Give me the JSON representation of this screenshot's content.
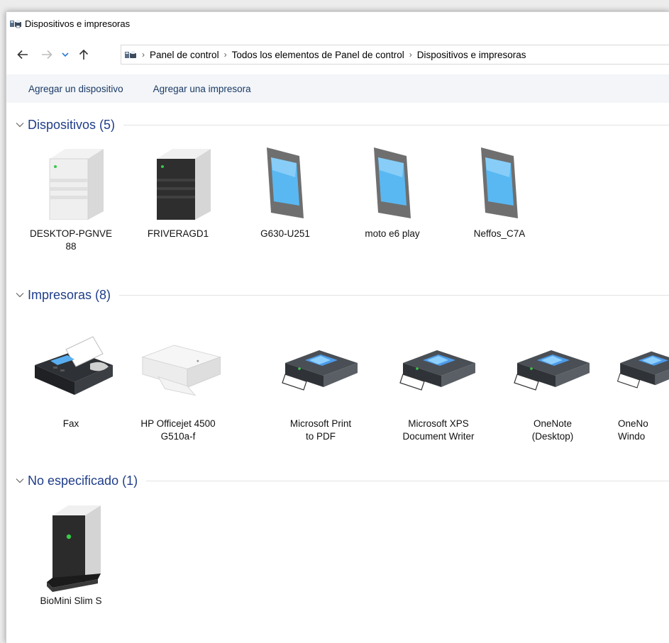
{
  "window": {
    "title": "Dispositivos e impresoras"
  },
  "nav": {
    "breadcrumbs": [
      "Panel de control",
      "Todos los elementos de Panel de control",
      "Dispositivos e impresoras"
    ]
  },
  "toolbar": {
    "add_device": "Agregar un dispositivo",
    "add_printer": "Agregar una impresora"
  },
  "groups": {
    "devices": {
      "title": "Dispositivos (5)",
      "items": [
        {
          "label": "DESKTOP-PGNVE\n88",
          "icon": "desktop-tower-icon"
        },
        {
          "label": "FRIVERAGD1",
          "icon": "server-tower-icon"
        },
        {
          "label": "G630-U251",
          "icon": "phone-icon"
        },
        {
          "label": "moto e6 play",
          "icon": "phone-icon"
        },
        {
          "label": "Neffos_C7A",
          "icon": "phone-icon"
        }
      ]
    },
    "printers": {
      "title": "Impresoras (8)",
      "items": [
        {
          "label": "Fax",
          "icon": "fax-icon"
        },
        {
          "label": "HP Officejet 4500\nG510a-f",
          "icon": "inkjet-printer-icon"
        },
        {
          "label": "Microsoft Print\nto PDF",
          "icon": "printer-icon"
        },
        {
          "label": "Microsoft XPS\nDocument Writer",
          "icon": "printer-icon"
        },
        {
          "label": "OneNote\n(Desktop)",
          "icon": "printer-icon"
        },
        {
          "label": "OneNo\nWindo",
          "icon": "printer-icon"
        }
      ]
    },
    "unspecified": {
      "title": "No especificado (1)",
      "items": [
        {
          "label": "BioMini Slim S",
          "icon": "fingerprint-reader-icon"
        }
      ]
    }
  },
  "colors": {
    "group_title": "#1f3d8a",
    "toolbar_bg": "#f3f5f8",
    "toolbar_text": "#1a3a66"
  }
}
